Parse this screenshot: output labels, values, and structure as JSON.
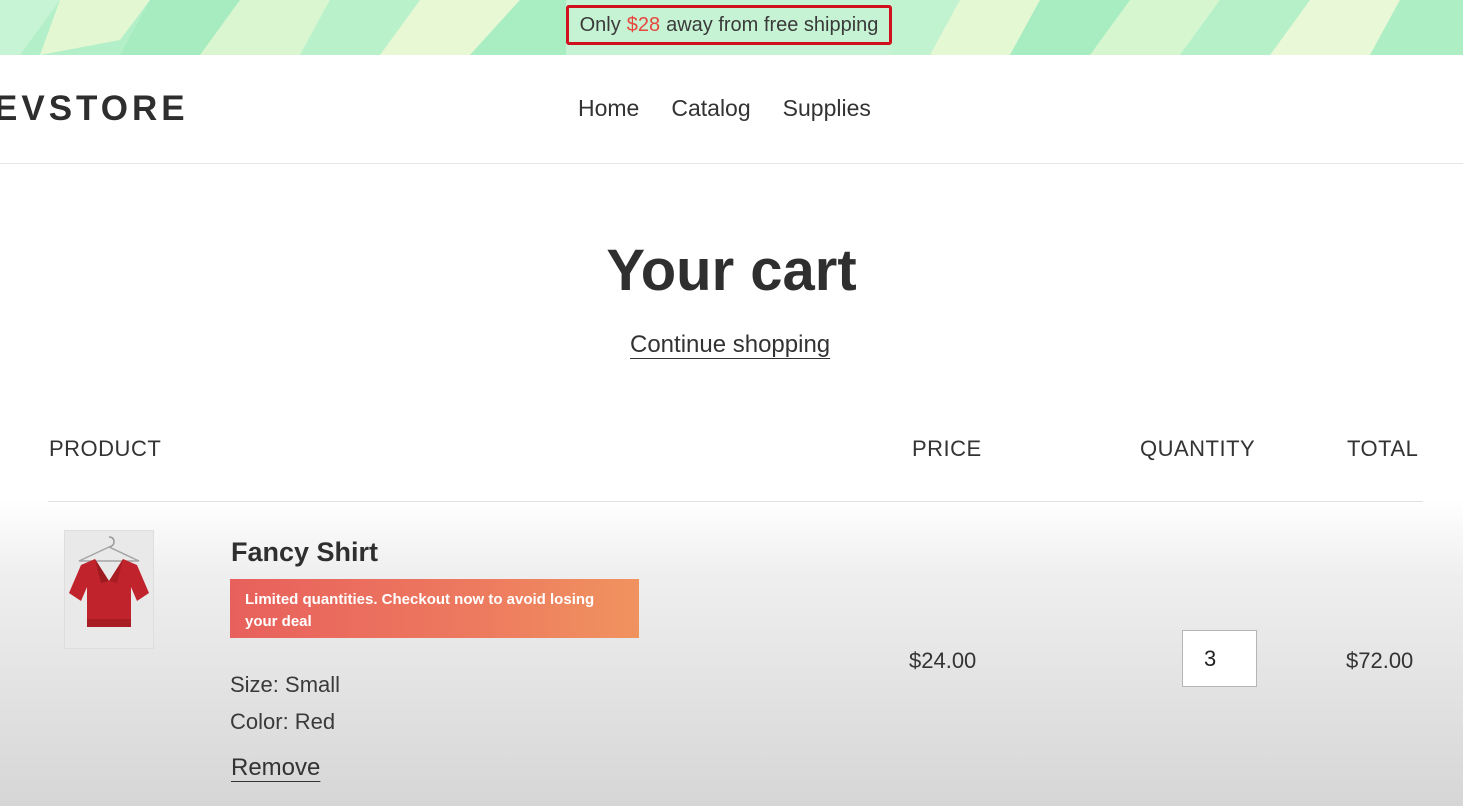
{
  "announcement": {
    "prefix": "Only",
    "amount": "$28",
    "suffix": "away from free shipping",
    "amount_color": "#e8453c",
    "highlight_border_color": "#d0101c"
  },
  "header": {
    "logo": "EVSTORE",
    "nav": [
      "Home",
      "Catalog",
      "Supplies"
    ]
  },
  "cart": {
    "title": "Your cart",
    "continue_shopping": "Continue shopping",
    "columns": {
      "product": "PRODUCT",
      "price": "PRICE",
      "quantity": "QUANTITY",
      "total": "TOTAL"
    },
    "items": [
      {
        "name": "Fancy Shirt",
        "thumbnail_icon": "red-shirt-on-hanger-icon",
        "urgency_message": "Limited quantities. Checkout now to avoid losing your deal",
        "size": "Size: Small",
        "color": "Color: Red",
        "remove_label": "Remove",
        "price": "$24.00",
        "quantity": "3",
        "total": "$72.00"
      }
    ]
  }
}
